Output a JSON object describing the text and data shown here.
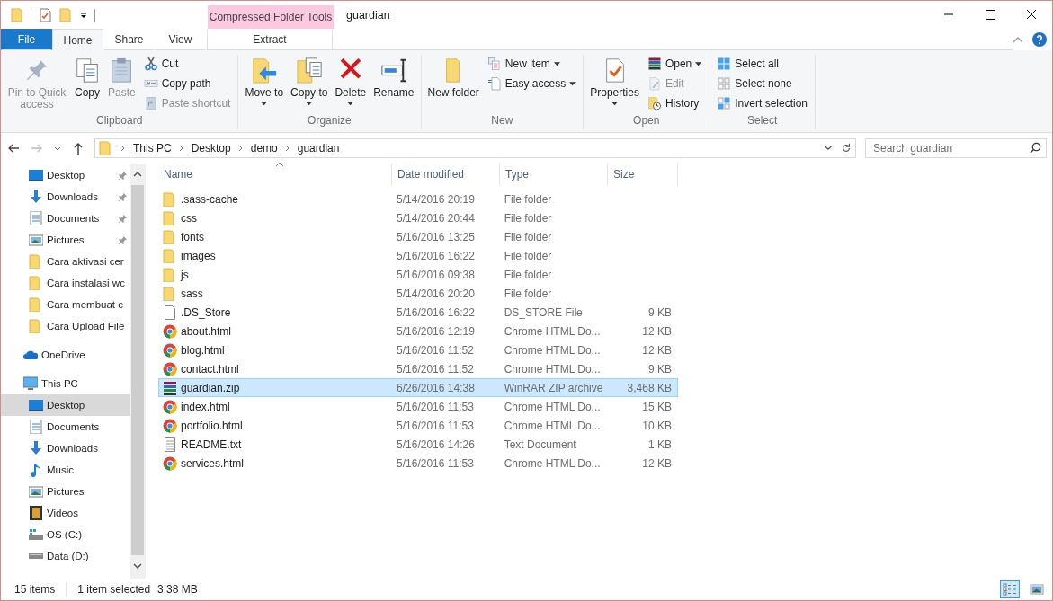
{
  "title_bar": {
    "title": "guardian",
    "context_group": "Compressed Folder Tools"
  },
  "ribbon_tabs": [
    {
      "label": "File",
      "kind": "file",
      "selected": false
    },
    {
      "label": "Home",
      "kind": "tab",
      "selected": true
    },
    {
      "label": "Share",
      "kind": "tab",
      "selected": false
    },
    {
      "label": "View",
      "kind": "tab",
      "selected": false
    },
    {
      "label": "Extract",
      "kind": "context",
      "selected": false
    }
  ],
  "ribbon_groups": [
    {
      "label": "Clipboard",
      "items": [
        {
          "label": "Pin to Quick access",
          "kind": "large",
          "disabled": true,
          "dropdown": false
        },
        {
          "label": "Copy",
          "kind": "large",
          "disabled": false,
          "dropdown": false
        },
        {
          "label": "Paste",
          "kind": "large",
          "disabled": true,
          "dropdown": false
        },
        {
          "label": "Cut",
          "kind": "small",
          "disabled": false,
          "dropdown": false
        },
        {
          "label": "Copy path",
          "kind": "small",
          "disabled": false,
          "dropdown": false
        },
        {
          "label": "Paste shortcut",
          "kind": "small",
          "disabled": true,
          "dropdown": false
        }
      ]
    },
    {
      "label": "Organize",
      "items": [
        {
          "label": "Move to",
          "kind": "large",
          "disabled": false,
          "dropdown": true
        },
        {
          "label": "Copy to",
          "kind": "large",
          "disabled": false,
          "dropdown": true
        },
        {
          "label": "Delete",
          "kind": "large",
          "disabled": false,
          "dropdown": true
        },
        {
          "label": "Rename",
          "kind": "large",
          "disabled": false,
          "dropdown": false
        }
      ]
    },
    {
      "label": "New",
      "items": [
        {
          "label": "New folder",
          "kind": "large",
          "disabled": false,
          "dropdown": false
        },
        {
          "label": "New item",
          "kind": "small",
          "disabled": false,
          "dropdown": true
        },
        {
          "label": "Easy access",
          "kind": "small",
          "disabled": false,
          "dropdown": true
        }
      ]
    },
    {
      "label": "Open",
      "items": [
        {
          "label": "Properties",
          "kind": "large",
          "disabled": false,
          "dropdown": true
        },
        {
          "label": "Open",
          "kind": "small",
          "disabled": false,
          "dropdown": true
        },
        {
          "label": "Edit",
          "kind": "small",
          "disabled": true,
          "dropdown": false
        },
        {
          "label": "History",
          "kind": "small",
          "disabled": false,
          "dropdown": false
        }
      ]
    },
    {
      "label": "Select",
      "items": [
        {
          "label": "Select all",
          "kind": "small",
          "disabled": false,
          "dropdown": false
        },
        {
          "label": "Select none",
          "kind": "small",
          "disabled": false,
          "dropdown": false
        },
        {
          "label": "Invert selection",
          "kind": "small",
          "disabled": false,
          "dropdown": false
        }
      ]
    }
  ],
  "address_bar": {
    "path": [
      "This PC",
      "Desktop",
      "demo",
      "guardian"
    ]
  },
  "search": {
    "placeholder": "Search guardian"
  },
  "nav_pane": {
    "pinned": [
      {
        "label": "Desktop",
        "kind": "desktop",
        "pinned": true,
        "selected": false
      },
      {
        "label": "Downloads",
        "kind": "downloads",
        "pinned": true,
        "selected": false
      },
      {
        "label": "Documents",
        "kind": "documents",
        "pinned": true,
        "selected": false
      },
      {
        "label": "Pictures",
        "kind": "pictures",
        "pinned": true,
        "selected": false
      },
      {
        "label": "Cara aktivasi cer",
        "kind": "folder",
        "pinned": false,
        "selected": false
      },
      {
        "label": "Cara instalasi wc",
        "kind": "folder",
        "pinned": false,
        "selected": false
      },
      {
        "label": "Cara membuat c",
        "kind": "folder",
        "pinned": false,
        "selected": false
      },
      {
        "label": "Cara Upload File",
        "kind": "folder",
        "pinned": false,
        "selected": false
      }
    ],
    "roots": [
      {
        "label": "OneDrive",
        "kind": "cloud",
        "selected": false
      },
      {
        "label": "This PC",
        "kind": "pc",
        "selected": false,
        "children": [
          {
            "label": "Desktop",
            "kind": "desktop",
            "selected": true
          },
          {
            "label": "Documents",
            "kind": "documents",
            "selected": false
          },
          {
            "label": "Downloads",
            "kind": "downloads",
            "selected": false
          },
          {
            "label": "Music",
            "kind": "music",
            "selected": false
          },
          {
            "label": "Pictures",
            "kind": "pictures",
            "selected": false
          },
          {
            "label": "Videos",
            "kind": "videos",
            "selected": false
          },
          {
            "label": "OS (C:)",
            "kind": "osdrive",
            "selected": false
          },
          {
            "label": "Data (D:)",
            "kind": "drive",
            "selected": false
          }
        ]
      }
    ]
  },
  "file_list": {
    "columns": [
      {
        "label": "Name",
        "sorted": true
      },
      {
        "label": "Date modified",
        "sorted": false
      },
      {
        "label": "Type",
        "sorted": false
      },
      {
        "label": "Size",
        "sorted": false
      }
    ],
    "rows": [
      {
        "name": ".sass-cache",
        "date": "5/14/2016 20:19",
        "type": "File folder",
        "size": "",
        "kind": "folder",
        "selected": false
      },
      {
        "name": "css",
        "date": "5/14/2016 20:44",
        "type": "File folder",
        "size": "",
        "kind": "folder",
        "selected": false
      },
      {
        "name": "fonts",
        "date": "5/16/2016 13:25",
        "type": "File folder",
        "size": "",
        "kind": "folder",
        "selected": false
      },
      {
        "name": "images",
        "date": "5/16/2016 16:22",
        "type": "File folder",
        "size": "",
        "kind": "folder",
        "selected": false
      },
      {
        "name": "js",
        "date": "5/16/2016 09:38",
        "type": "File folder",
        "size": "",
        "kind": "folder",
        "selected": false
      },
      {
        "name": "sass",
        "date": "5/14/2016 20:20",
        "type": "File folder",
        "size": "",
        "kind": "folder",
        "selected": false
      },
      {
        "name": ".DS_Store",
        "date": "5/16/2016 16:22",
        "type": "DS_STORE File",
        "size": "9 KB",
        "kind": "file",
        "selected": false
      },
      {
        "name": "about.html",
        "date": "5/16/2016 12:19",
        "type": "Chrome HTML Do...",
        "size": "12 KB",
        "kind": "web",
        "selected": false
      },
      {
        "name": "blog.html",
        "date": "5/16/2016 11:52",
        "type": "Chrome HTML Do...",
        "size": "12 KB",
        "kind": "web",
        "selected": false
      },
      {
        "name": "contact.html",
        "date": "5/16/2016 11:52",
        "type": "Chrome HTML Do...",
        "size": "9 KB",
        "kind": "web",
        "selected": false
      },
      {
        "name": "guardian.zip",
        "date": "6/26/2016 14:38",
        "type": "WinRAR ZIP archive",
        "size": "3,468 KB",
        "kind": "archive",
        "selected": true
      },
      {
        "name": "index.html",
        "date": "5/16/2016 11:53",
        "type": "Chrome HTML Do...",
        "size": "15 KB",
        "kind": "web",
        "selected": false
      },
      {
        "name": "portfolio.html",
        "date": "5/16/2016 11:53",
        "type": "Chrome HTML Do...",
        "size": "10 KB",
        "kind": "web",
        "selected": false
      },
      {
        "name": "README.txt",
        "date": "5/16/2016 14:26",
        "type": "Text Document",
        "size": "1 KB",
        "kind": "text",
        "selected": false
      },
      {
        "name": "services.html",
        "date": "5/16/2016 11:53",
        "type": "Chrome HTML Do...",
        "size": "12 KB",
        "kind": "web",
        "selected": false
      }
    ]
  },
  "status_bar": {
    "item_count": "15 items",
    "selection": "1 item selected",
    "selection_size": "3.38 MB",
    "views": [
      {
        "kind": "details",
        "selected": true
      },
      {
        "kind": "large-icons",
        "selected": false
      }
    ]
  }
}
